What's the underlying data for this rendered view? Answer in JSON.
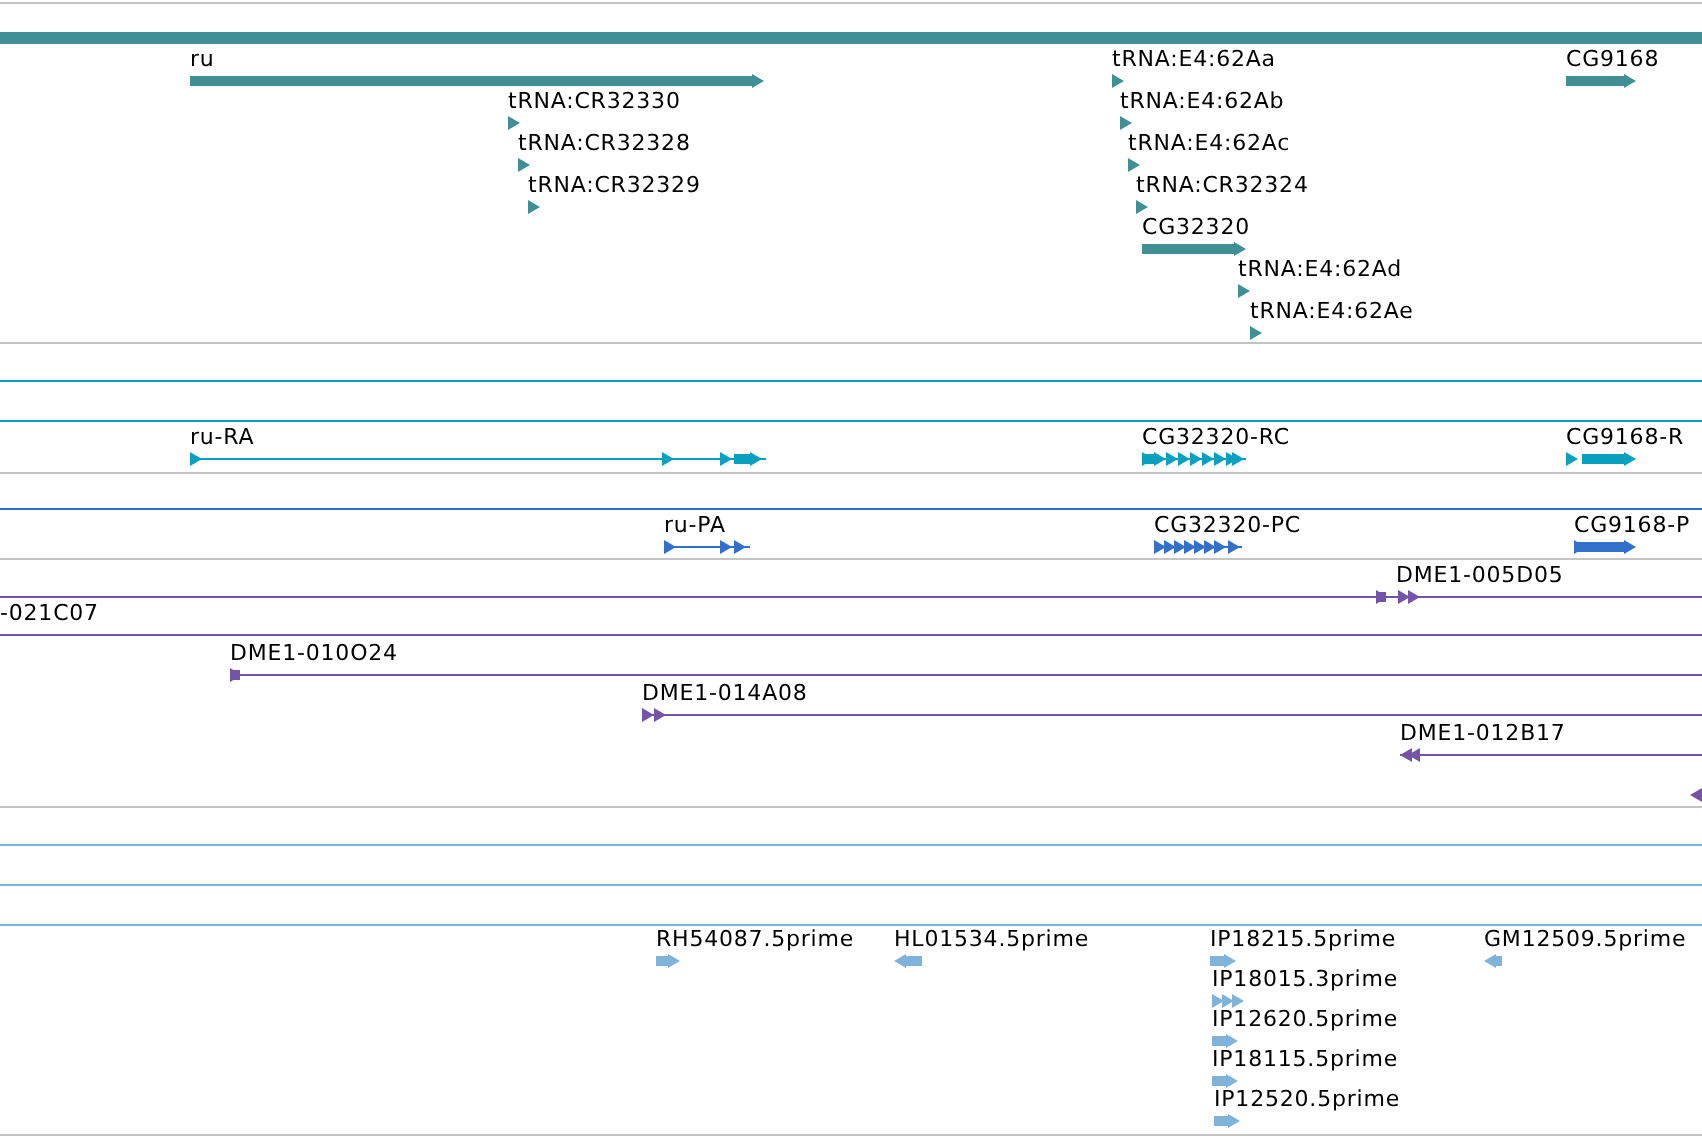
{
  "tracks": [
    {
      "kind": "gene",
      "color": "#3f8f94",
      "features": [
        {
          "label": "ru",
          "reverse": false
        },
        {
          "label": "tRNA:CR32330",
          "reverse": false
        },
        {
          "label": "tRNA:CR32328",
          "reverse": false
        },
        {
          "label": "tRNA:CR32329",
          "reverse": false
        },
        {
          "label": "tRNA:E4:62Aa",
          "reverse": false
        },
        {
          "label": "tRNA:E4:62Ab",
          "reverse": false
        },
        {
          "label": "tRNA:E4:62Ac",
          "reverse": false
        },
        {
          "label": "tRNA:CR32324",
          "reverse": false
        },
        {
          "label": "CG32320",
          "reverse": false
        },
        {
          "label": "tRNA:E4:62Ad",
          "reverse": false
        },
        {
          "label": "tRNA:E4:62Ae",
          "reverse": false
        },
        {
          "label": "CG9168",
          "reverse": false
        }
      ]
    },
    {
      "kind": "transcript",
      "color": "#0aa0c0",
      "features": [
        {
          "label": "ru-RA",
          "reverse": false
        },
        {
          "label": "CG32320-RC",
          "reverse": false
        },
        {
          "label": "CG9168-R",
          "reverse": false
        }
      ]
    },
    {
      "kind": "protein",
      "color": "#3370c9",
      "features": [
        {
          "label": "ru-PA",
          "reverse": false
        },
        {
          "label": "CG32320-PC",
          "reverse": false
        },
        {
          "label": "CG9168-P",
          "reverse": false
        }
      ]
    },
    {
      "kind": "clone",
      "color": "#7454a8",
      "features": [
        {
          "label": "DME1-005D05",
          "reverse": false
        },
        {
          "label": "-021C07"
        },
        {
          "label": "DME1-010O24",
          "reverse": false
        },
        {
          "label": "DME1-014A08",
          "reverse": false
        },
        {
          "label": "DME1-012B17",
          "reverse": true
        },
        {
          "reverse": true
        }
      ]
    },
    {
      "kind": "est",
      "color": "#7fb3d9",
      "features": [
        {
          "label": "RH54087.5prime",
          "reverse": false
        },
        {
          "label": "HL01534.5prime",
          "reverse": true
        },
        {
          "label": "IP18215.5prime",
          "reverse": false
        },
        {
          "label": "IP18015.3prime",
          "reverse": false
        },
        {
          "label": "IP12620.5prime",
          "reverse": false
        },
        {
          "label": "IP18115.5prime",
          "reverse": false
        },
        {
          "label": "IP12520.5prime",
          "reverse": false
        },
        {
          "label": "GM12509.5prime",
          "reverse": true
        }
      ]
    }
  ]
}
